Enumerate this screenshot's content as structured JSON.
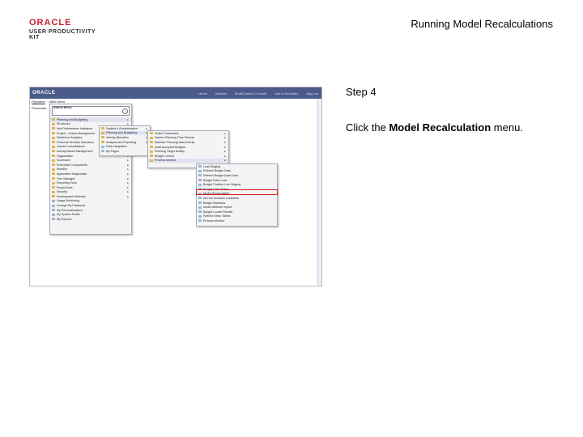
{
  "header": {
    "logo_oracle": "ORACLE",
    "logo_sub": "USER PRODUCTIVITY KIT",
    "title": "Running Model Recalculations"
  },
  "step": {
    "label": "Step 4",
    "instruction_pre": "Click the ",
    "instruction_bold": "Model Recalculation",
    "instruction_post": " menu."
  },
  "screenshot": {
    "logo": "ORACLE",
    "topnav": [
      "Home",
      "Worklist",
      "MultiChannel Console",
      "Add to Favorites",
      "Sign out"
    ],
    "favbar": [
      "Favorites",
      "Main Menu"
    ],
    "menu_label": "Financials,",
    "search_label": "Search Menu:",
    "menu_level1": [
      "Planning and Budgeting",
      "Structures",
      "Key Performance Indicators",
      "Project - Grants Management",
      "Workforce Analytics",
      "Financial Services Industries",
      "Global Consolidations",
      "Activity Based Management",
      "Organization",
      "Scorecard",
      "Enterprise Components",
      "Worklist",
      "Application Diagnostics",
      "Tree Manager",
      "Reporting Tools",
      "PeopleTools",
      "Security",
      "Development Methods",
      "Usage Monitoring",
      "Change My Password",
      "My Personalizations",
      "My System Profile",
      "My Reports"
    ],
    "menu_level2": [
      "System & Administration",
      "Planning and Budgeting",
      "Activity Allocation",
      "Analysis and Reporting",
      "Data Integration",
      "My Pages"
    ],
    "menu_level3": [
      "Define Parameters",
      "System Planning Time Periods",
      "Maintain Planning Data Activity",
      "Audit Accepted Budgets",
      "Planning Target Activity",
      "Budget Control",
      "Process Monitor"
    ],
    "menu_level4": [
      "Load Staging",
      "Refresh Budget Data",
      "Refresh Budget Data Cube",
      "Budget Data Load",
      "Budget Position Line Staging",
      "Budget Data Status",
      "Model Recalculation",
      "Ad Hoc Scenario Lockdown",
      "Budget Balances",
      "Model Attribute Import",
      "Budget Locate Results",
      "Refresh Temp Tables",
      "Process Monitor"
    ],
    "highlight_index": 6,
    "colors": {
      "banner": "#4a5a8a",
      "highlight_box": "#d01c1c",
      "logo_red": "#c8202a"
    }
  }
}
